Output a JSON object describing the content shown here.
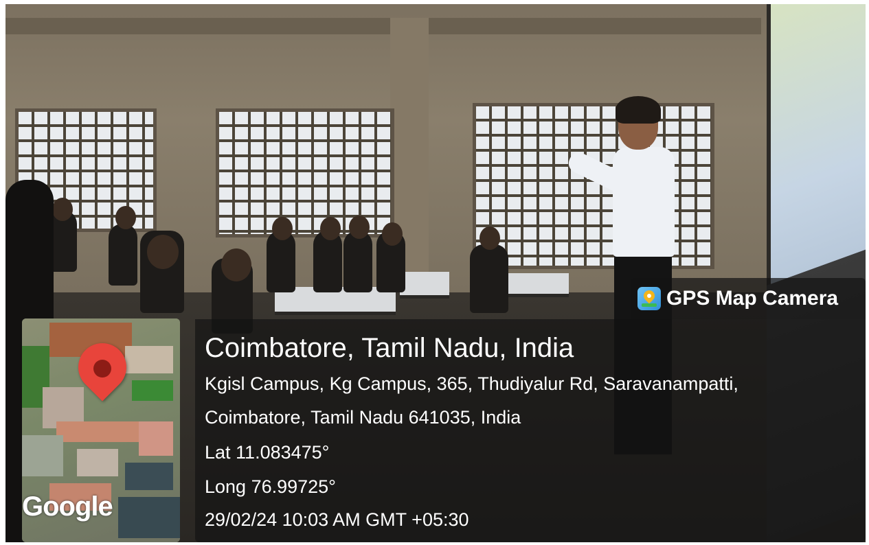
{
  "badge": {
    "icon": "gps-map-camera-icon",
    "label": "GPS Map Camera",
    "icon_color": "#2f8fd8"
  },
  "map": {
    "brand": "Google",
    "pin_color": "#e8443b"
  },
  "location": {
    "place": "Coimbatore, Tamil Nadu, India",
    "address_line1": "Kgisl Campus, Kg Campus, 365, Thudiyalur Rd, Saravanampatti,",
    "address_line2": "Coimbatore, Tamil Nadu 641035, India",
    "latitude": "Lat 11.083475°",
    "longitude": "Long 76.99725°",
    "datetime": "29/02/24 10:03 AM GMT +05:30"
  }
}
